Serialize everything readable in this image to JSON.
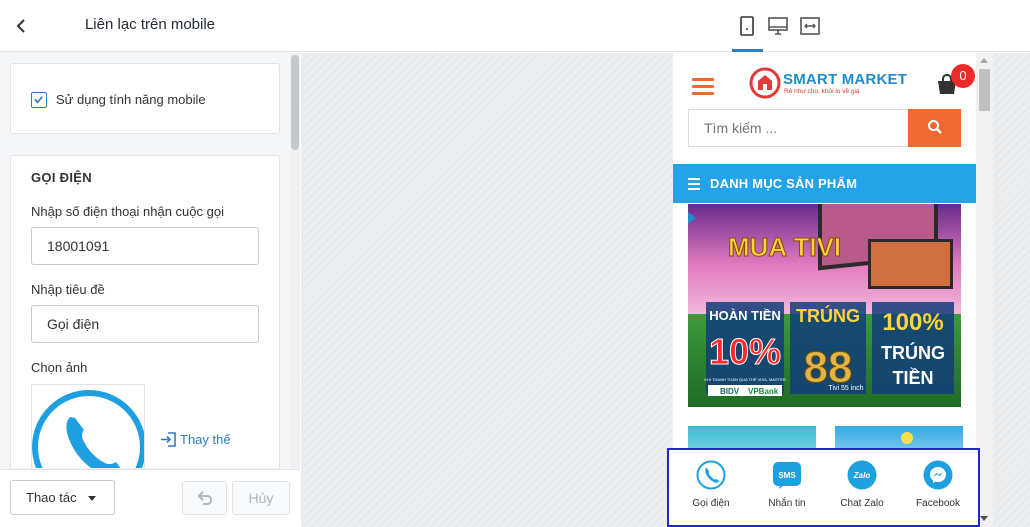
{
  "panel": {
    "title": "Liên lạc trên mobile",
    "toggle_label": "Sử dụng tính năng mobile",
    "toggle_checked": true,
    "call_section": {
      "title": "GỌI ĐIỆN",
      "phone_label": "Nhập số điện thoại nhận cuộc gọi",
      "phone_value": "18001091",
      "title_label": "Nhập tiêu đề",
      "title_value": "Gọi điện",
      "image_label": "Chọn ảnh",
      "replace_label": "Thay thế"
    },
    "footer": {
      "actions_label": "Thao tác",
      "cancel_label": "Hủy"
    }
  },
  "preview": {
    "active_device": "mobile",
    "store": {
      "logo_text": "SMART MARKET",
      "tagline": "Rẻ như cho, khỏi lo về giá",
      "cart_count": "0",
      "search_placeholder": "Tìm kiếm ...",
      "category_label": "DANH MỤC SẢN PHẨM"
    },
    "banner": {
      "headline": "MUA TIVI",
      "offer_1_title": "HOÀN TIỀN",
      "offer_1_value": "10%",
      "offer_2_title": "TRÚNG",
      "offer_2_value": "88",
      "offer_2_note": "Tivi 55 inch",
      "offer_3_value": "100%",
      "offer_3_title": "TRÚNG",
      "offer_3_sub": "TIỀN",
      "fineprint": "KHI THANH TOÁN QUA THẺ VISA, MASTER",
      "bank_1": "BIDV",
      "bank_2": "VPBank"
    },
    "contact_bar": {
      "items": [
        {
          "label": "Gọi điện",
          "icon": "phone-icon"
        },
        {
          "label": "Nhắn tin",
          "icon": "sms-icon"
        },
        {
          "label": "Chat Zalo",
          "icon": "zalo-icon"
        },
        {
          "label": "Facebook",
          "icon": "messenger-icon"
        }
      ],
      "sms_badge": "SMS",
      "zalo_badge": "Zalo"
    }
  },
  "colors": {
    "accent": "#2e7fc2",
    "store_orange": "#ee6a2f",
    "category_blue": "#24a3e8",
    "contact_icon": "#1ea0e0",
    "highlight_border": "#1f28c9"
  }
}
